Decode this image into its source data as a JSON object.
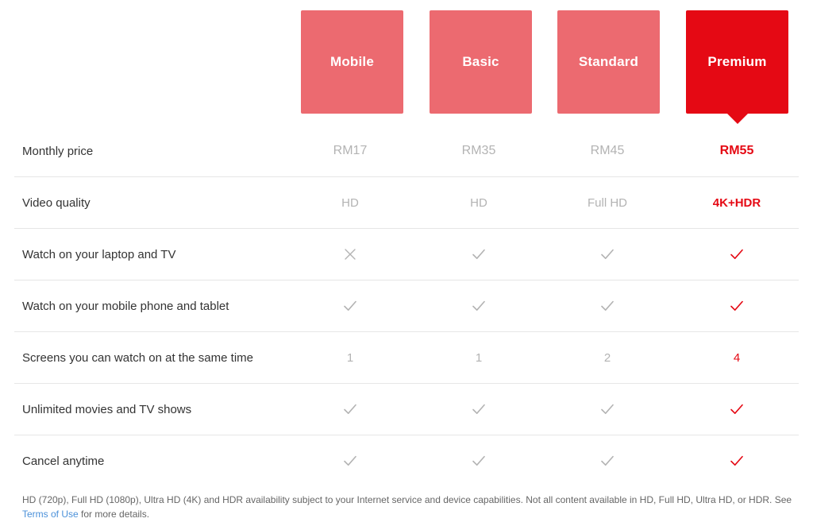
{
  "colors": {
    "plan_accent": "#EC6A70",
    "premium_accent": "#E50914",
    "muted_text": "#b3b3b3",
    "label_text": "#333333",
    "link": "#4a90d9",
    "divider": "#e6e6e6"
  },
  "plans": [
    {
      "name": "Mobile",
      "highlighted": false
    },
    {
      "name": "Basic",
      "highlighted": false
    },
    {
      "name": "Standard",
      "highlighted": false
    },
    {
      "name": "Premium",
      "highlighted": true
    }
  ],
  "rows": [
    {
      "label": "Monthly price",
      "type": "text",
      "values": [
        "RM17",
        "RM35",
        "RM45",
        "RM55"
      ]
    },
    {
      "label": "Video quality",
      "type": "text",
      "values": [
        "HD",
        "HD",
        "Full HD",
        "4K+HDR"
      ]
    },
    {
      "label": "Watch on your laptop and TV",
      "type": "icon",
      "values": [
        "cross",
        "check",
        "check",
        "check"
      ]
    },
    {
      "label": "Watch on your mobile phone and tablet",
      "type": "icon",
      "values": [
        "check",
        "check",
        "check",
        "check"
      ]
    },
    {
      "label": "Screens you can watch on at the same time",
      "type": "text",
      "values": [
        "1",
        "1",
        "2",
        "4"
      ]
    },
    {
      "label": "Unlimited movies and TV shows",
      "type": "icon",
      "values": [
        "check",
        "check",
        "check",
        "check"
      ]
    },
    {
      "label": "Cancel anytime",
      "type": "icon",
      "values": [
        "check",
        "check",
        "check",
        "check"
      ]
    }
  ],
  "footnote": {
    "part1": "HD (720p), Full HD (1080p), Ultra HD (4K) and HDR availability subject to your Internet service and device capabilities. Not all content available in HD, Full HD, Ultra HD, or HDR. See ",
    "link_text": "Terms of Use",
    "part2": " for more details."
  },
  "icons": {
    "check": "check-icon",
    "cross": "cross-icon",
    "caret": "caret-down-icon"
  }
}
